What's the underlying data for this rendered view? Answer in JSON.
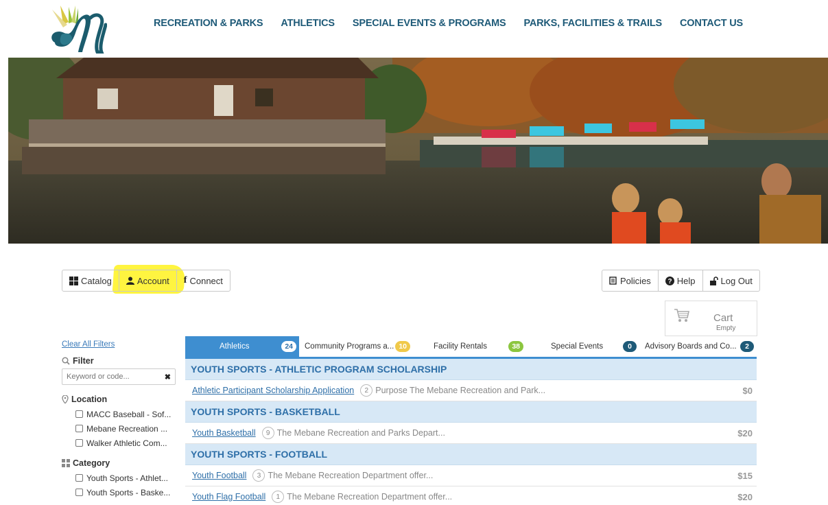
{
  "nav": {
    "items": [
      "RECREATION & PARKS",
      "ATHLETICS",
      "SPECIAL EVENTS & PROGRAMS",
      "PARKS, FACILITIES & TRAILS",
      "CONTACT US"
    ]
  },
  "toolbar": {
    "catalog_label": "Catalog",
    "account_label": "Account",
    "connect_label": "Connect",
    "policies_label": "Policies",
    "help_label": "Help",
    "logout_label": "Log Out"
  },
  "cart": {
    "label": "Cart",
    "status": "Empty"
  },
  "sidebar": {
    "clear_filters": "Clear All Filters",
    "filter_heading": "Filter",
    "keyword_placeholder": "Keyword or code...",
    "location_heading": "Location",
    "locations": [
      "MACC Baseball - Sof...",
      "Mebane Recreation ...",
      "Walker Athletic Com..."
    ],
    "category_heading": "Category",
    "categories": [
      "Youth Sports - Athlet...",
      "Youth Sports - Baske..."
    ]
  },
  "tabs": [
    {
      "label": "Athletics",
      "count": "24",
      "color": "#ffffff"
    },
    {
      "label": "Community Programs a...",
      "count": "10",
      "color": "#f0c94a"
    },
    {
      "label": "Facility Rentals",
      "count": "38",
      "color": "#8cc63f"
    },
    {
      "label": "Special Events",
      "count": "0",
      "color": "#1e5a78"
    },
    {
      "label": "Advisory Boards and Co...",
      "count": "2",
      "color": "#1e5a78"
    }
  ],
  "catalog": {
    "sections": [
      {
        "heading": "YOUTH SPORTS - ATHLETIC PROGRAM SCHOLARSHIP",
        "rows": [
          {
            "name": "Athletic Participant Scholarship Application",
            "count": "2",
            "desc": "Purpose The Mebane Recreation and Park...",
            "price": "$0"
          }
        ]
      },
      {
        "heading": "YOUTH SPORTS - BASKETBALL",
        "rows": [
          {
            "name": "Youth Basketball",
            "count": "9",
            "desc": "The Mebane Recreation and Parks Depart...",
            "price": "$20"
          }
        ]
      },
      {
        "heading": "YOUTH SPORTS - FOOTBALL",
        "rows": [
          {
            "name": "Youth Football",
            "count": "3",
            "desc": "The Mebane Recreation Department offer...",
            "price": "$15"
          },
          {
            "name": "Youth Flag Football",
            "count": "1",
            "desc": "The Mebane Recreation Department offer...",
            "price": "$20"
          }
        ]
      }
    ]
  },
  "colors": {
    "nav_text": "#1e5a78",
    "accent_blue": "#3e8ed0",
    "section_bg": "#d7e8f6",
    "highlight": "#fff000"
  }
}
